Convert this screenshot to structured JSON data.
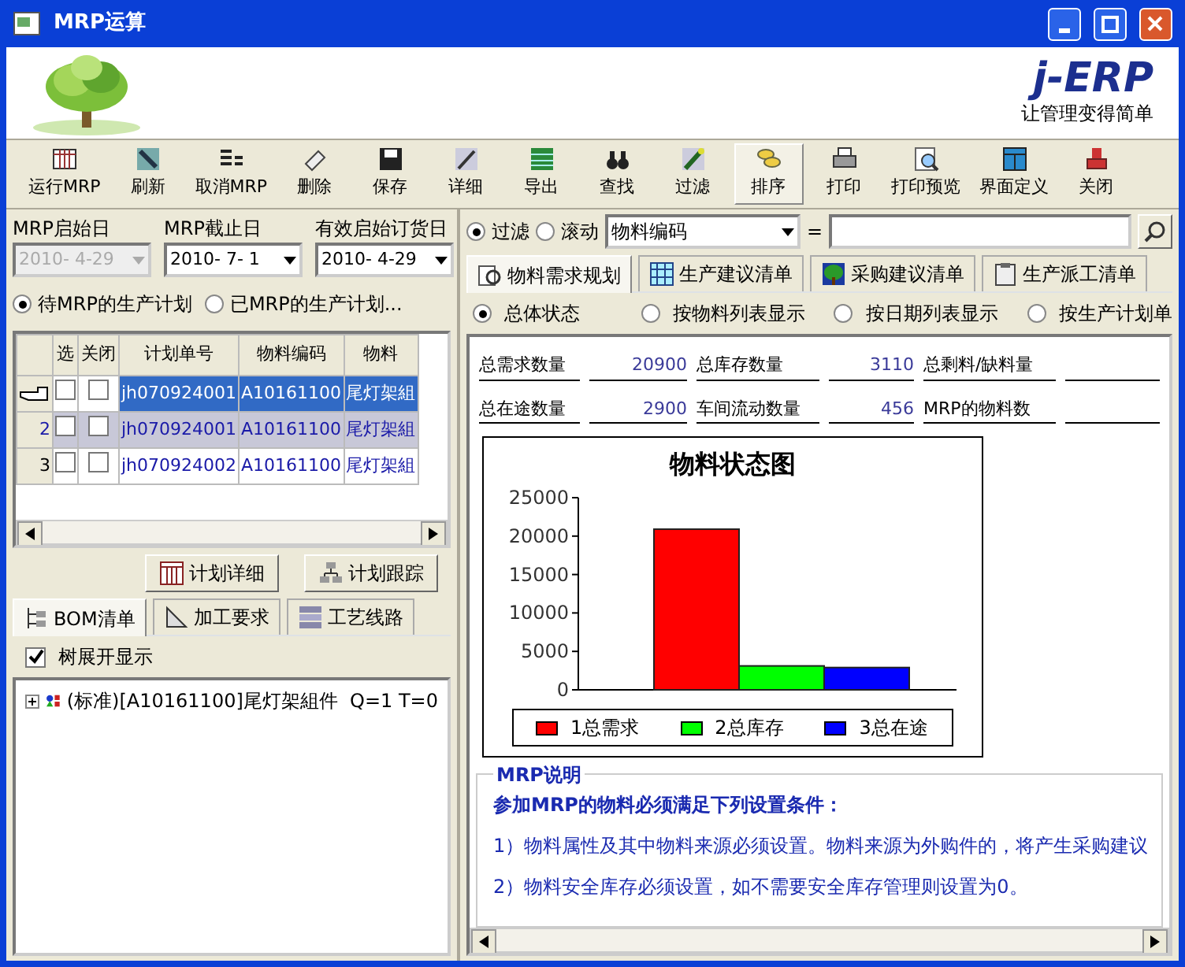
{
  "window": {
    "title": "MRP运算"
  },
  "banner": {
    "logo": "j-ERP",
    "slogan": "让管理变得简单"
  },
  "toolbar": [
    {
      "label": "运行MRP",
      "selected": false
    },
    {
      "label": "刷新",
      "selected": false
    },
    {
      "label": "取消MRP",
      "selected": false
    },
    {
      "label": "删除",
      "selected": false
    },
    {
      "label": "保存",
      "selected": false
    },
    {
      "label": "详细",
      "selected": false
    },
    {
      "label": "导出",
      "selected": false
    },
    {
      "label": "查找",
      "selected": false
    },
    {
      "label": "过滤",
      "selected": false
    },
    {
      "label": "排序",
      "selected": true
    },
    {
      "label": "打印",
      "selected": false
    },
    {
      "label": "打印预览",
      "selected": false
    },
    {
      "label": "界面定义",
      "selected": false
    },
    {
      "label": "关闭",
      "selected": false
    }
  ],
  "left_panel": {
    "date_fields": [
      {
        "label": "MRP启始日",
        "value": "2010- 4-29",
        "disabled": true
      },
      {
        "label": "MRP截止日",
        "value": "2010- 7- 1",
        "disabled": false
      },
      {
        "label": "有效启始订货日",
        "value": "2010- 4-29",
        "disabled": false
      }
    ],
    "plan_filter": [
      {
        "label": "待MRP的生产计划",
        "selected": true
      },
      {
        "label": "已MRP的生产计划...",
        "selected": false
      }
    ],
    "plan_table": {
      "columns": [
        "选",
        "关闭",
        "计划单号",
        "物料编码",
        "物料"
      ],
      "rows": [
        {
          "selected": true,
          "select": false,
          "close": false,
          "plan_no": "jh070924001",
          "material_code": "A10161100",
          "material_name": "尾灯架組"
        },
        {
          "number": "2",
          "selected": false,
          "select": false,
          "close": false,
          "plan_no": "jh070924001",
          "material_code": "A10161100",
          "material_name": "尾灯架組"
        },
        {
          "number": "3",
          "selected": false,
          "select": false,
          "close": false,
          "plan_no": "jh070924002",
          "material_code": "A10161100",
          "material_name": "尾灯架組"
        }
      ]
    },
    "buttons": [
      "计划详细",
      "计划跟踪"
    ],
    "tabs": [
      {
        "label": "BOM清单",
        "selected": true
      },
      {
        "label": "加工要求",
        "selected": false
      },
      {
        "label": "工艺线路",
        "selected": false
      }
    ],
    "tree_expand": {
      "label": "树展开显示",
      "checked": true
    },
    "tree": [
      {
        "label": "(标准)[A10161100]尾灯架組件  Q=1 T=0",
        "expanded": false
      }
    ]
  },
  "right_panel": {
    "search_mode": [
      {
        "label": "过滤",
        "selected": true
      },
      {
        "label": "滚动",
        "selected": false
      }
    ],
    "field": {
      "value": "物料编码"
    },
    "operator": "=",
    "tabs": [
      {
        "label": "物料需求规划",
        "selected": true
      },
      {
        "label": "生产建议清单",
        "selected": false
      },
      {
        "label": "采购建议清单",
        "selected": false
      },
      {
        "label": "生产派工清单",
        "selected": false
      }
    ],
    "views": [
      {
        "label": "总体状态",
        "selected": true
      },
      {
        "label": "按物料列表显示",
        "selected": false
      },
      {
        "label": "按日期列表显示",
        "selected": false
      },
      {
        "label": "按生产计划单",
        "selected": false
      }
    ],
    "stats": [
      {
        "label": "总需求数量",
        "value": "20900"
      },
      {
        "label": "总库存数量",
        "value": "3110"
      },
      {
        "label": "总剩料/缺料量"
      },
      {
        "label": "总在途数量",
        "value": "2900"
      },
      {
        "label": "车间流动数量",
        "value": "456"
      },
      {
        "label": "MRP的物料数"
      }
    ],
    "chart_data": {
      "type": "bar",
      "title": "物料状态图",
      "legend": true,
      "ylim": [
        0,
        25000
      ],
      "yticks": [
        0,
        5000,
        10000,
        15000,
        20000,
        25000
      ],
      "series": [
        {
          "name": "1总需求",
          "color": "#ff0000",
          "values": [
            20900
          ]
        },
        {
          "name": "2总库存",
          "color": "#00ff00",
          "values": [
            3110
          ]
        },
        {
          "name": "3总在途",
          "color": "#0000ff",
          "values": [
            2900
          ]
        }
      ]
    },
    "notes": {
      "title": "MRP说明",
      "heading": "参加MRP的物料必须满足下列设置条件：",
      "lines": [
        "1）物料属性及其中物料来源必须设置。物料来源为外购件的，将产生采购建议",
        "2）物料安全库存必须设置，如不需要安全库存管理则设置为0。"
      ]
    }
  }
}
